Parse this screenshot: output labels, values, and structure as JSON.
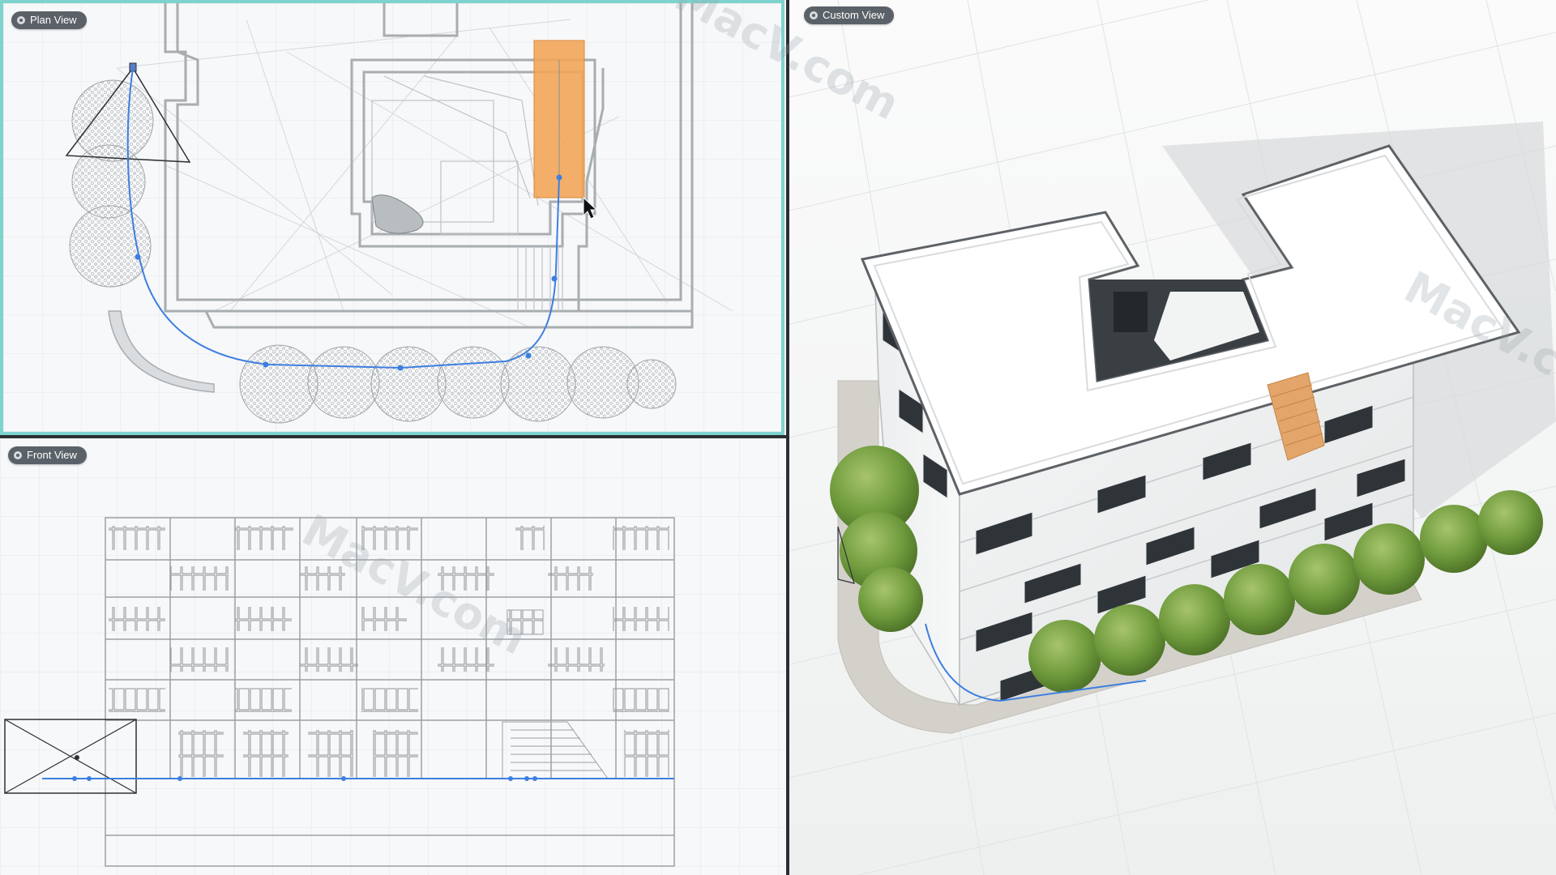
{
  "viewports": {
    "plan": {
      "label": "Plan View"
    },
    "front": {
      "label": "Front View"
    },
    "custom": {
      "label": "Custom View"
    }
  },
  "watermark": {
    "text": "MacV.com"
  },
  "colors": {
    "accent_active_border": "#7fd3cf",
    "camera_path": "#3d7fe0",
    "selection": "#f2a55a",
    "label_pill": "#5b6168",
    "tree_green": "#6e9a3c"
  },
  "icons": {
    "viewport_label_icon": "camera-view-icon",
    "pointer": "mouse-cursor-icon",
    "camera": "camera-frustum-icon"
  }
}
